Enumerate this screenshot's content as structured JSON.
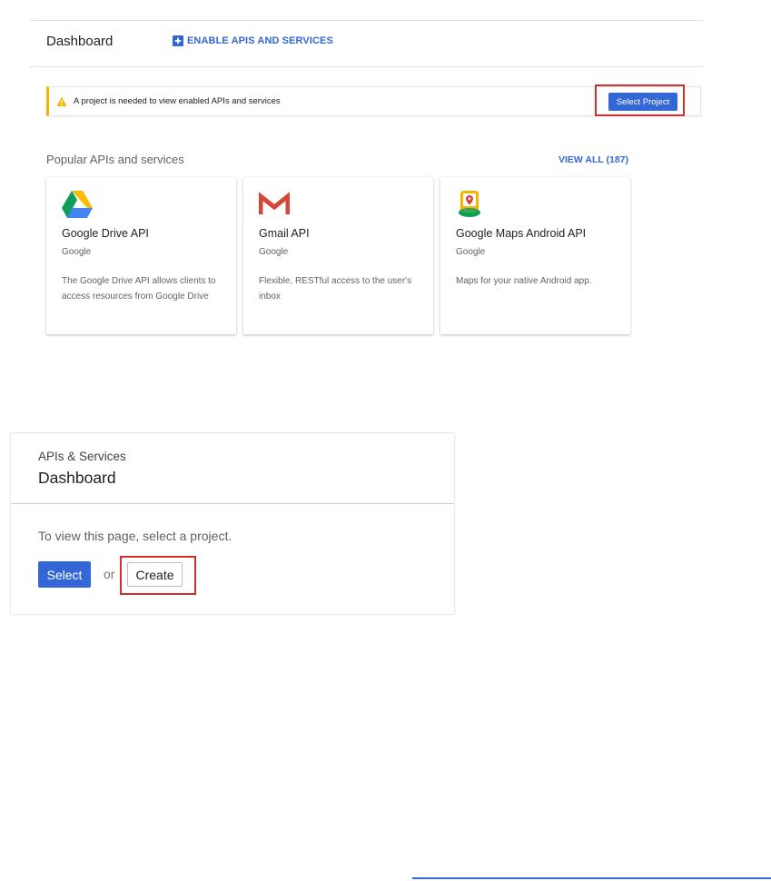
{
  "header": {
    "title": "Dashboard",
    "enable_label": "ENABLE APIS AND SERVICES"
  },
  "alert": {
    "message": "A project is needed to view enabled APIs and services",
    "button_label": "Select Project"
  },
  "popular": {
    "title": "Popular APIs and services",
    "view_all_label": "VIEW ALL (187)",
    "cards": [
      {
        "name": "Google Drive API",
        "vendor": "Google",
        "description": "The Google Drive API allows clients to access resources from Google Drive",
        "icon": "google-drive-icon"
      },
      {
        "name": "Gmail API",
        "vendor": "Google",
        "description": "Flexible, RESTful access to the user's inbox",
        "icon": "gmail-icon"
      },
      {
        "name": "Google Maps Android API",
        "vendor": "Google",
        "description": "Maps for your native Android app.",
        "icon": "maps-android-icon"
      }
    ]
  },
  "panel": {
    "subtitle": "APIs & Services",
    "title": "Dashboard",
    "message": "To view this page, select a project.",
    "select_label": "Select",
    "or_label": "or",
    "create_label": "Create"
  },
  "colors": {
    "accent": "#3367d6",
    "warning": "#f4b400",
    "highlight": "#d32f2f"
  }
}
